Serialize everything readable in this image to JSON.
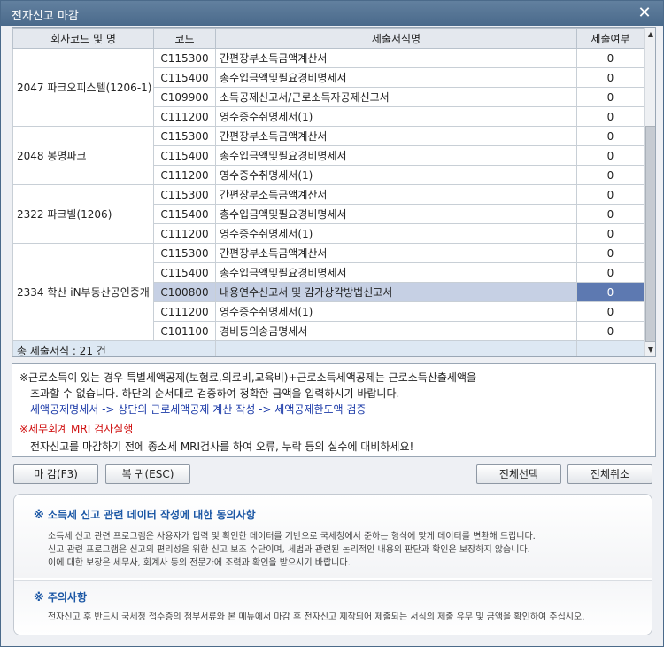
{
  "window": {
    "title": "전자신고 마감",
    "close_glyph": "✕"
  },
  "grid": {
    "headers": [
      "회사코드 및 명",
      "코드",
      "제출서식명",
      "제출여부"
    ],
    "companies": [
      {
        "name": "2047 파크오피스텔(1206-1)",
        "rows": [
          {
            "code": "C115300",
            "form": "간편장부소득금액계산서",
            "count": "0"
          },
          {
            "code": "C115400",
            "form": "총수입금액및필요경비명세서",
            "count": "0"
          },
          {
            "code": "C109900",
            "form": "소득공제신고서/근로소득자공제신고서",
            "count": "0"
          },
          {
            "code": "C111200",
            "form": "영수증수취명세서(1)",
            "count": "0"
          }
        ]
      },
      {
        "name": "2048 봉명파크",
        "rows": [
          {
            "code": "C115300",
            "form": "간편장부소득금액계산서",
            "count": "0"
          },
          {
            "code": "C115400",
            "form": "총수입금액및필요경비명세서",
            "count": "0"
          },
          {
            "code": "C111200",
            "form": "영수증수취명세서(1)",
            "count": "0"
          }
        ]
      },
      {
        "name": "2322 파크빌(1206)",
        "rows": [
          {
            "code": "C115300",
            "form": "간편장부소득금액계산서",
            "count": "0"
          },
          {
            "code": "C115400",
            "form": "총수입금액및필요경비명세서",
            "count": "0"
          },
          {
            "code": "C111200",
            "form": "영수증수취명세서(1)",
            "count": "0"
          }
        ]
      },
      {
        "name": "2334 학산 iN부동산공인중개",
        "rows": [
          {
            "code": "C115300",
            "form": "간편장부소득금액계산서",
            "count": "0"
          },
          {
            "code": "C115400",
            "form": "총수입금액및필요경비명세서",
            "count": "0"
          },
          {
            "code": "C100800",
            "form": "내용연수신고서 및 감가상각방법신고서",
            "count": "0",
            "selected": true
          },
          {
            "code": "C111200",
            "form": "영수증수취명세서(1)",
            "count": "0"
          },
          {
            "code": "C101100",
            "form": "경비등의송금명세서",
            "count": "0"
          }
        ]
      }
    ],
    "total": "총 제출서식 : 21 건"
  },
  "notice": {
    "line1": "※근로소득이 있는 경우 특별세액공제(보험료,의료비,교육비)+근로소득세액공제는 근로소득산출세액을",
    "line2": "초과할 수 없습니다. 하단의 순서대로 검증하여 정확한 금액을 입력하시기 바랍니다.",
    "line3": "세액공제명세서 -> 상단의 근로세액공제 계산 작성 -> 세액공제한도액 검증",
    "line4": "※세무회계 MRI 검사실행",
    "line5": "전자신고를 마감하기 전에 종소세 MRI검사를 하여 오류, 누락 등의 실수에 대비하세요!"
  },
  "buttons": {
    "close": "마 감(F3)",
    "back": "복 귀(ESC)",
    "select_all": "전체선택",
    "cancel_all": "전체취소"
  },
  "consent": {
    "title1": "※ 소득세 신고 관련 데이터 작성에 대한 동의사항",
    "p1a": "소득세 신고 관련 프로그램은 사용자가 입력 및 확인한 데이터를 기반으로 국세청에서 준하는 형식에 맞게 데이터를 변환해 드립니다.",
    "p1b": "신고 관련 프로그램은 신고의 편리성을 위한 신고 보조 수단이며, 세법과 관련된 논리적인 내용의 판단과 확인은 보장하지 않습니다.",
    "p1c": "이에 대한 보장은 세무사, 회계사 등의 전문가에 조력과 확인을 받으시기 바랍니다.",
    "title2": "※ 주의사항",
    "p2": "전자신고 후 반드시 국세청 접수증의 첨부서류와 본 메뉴에서 마감 후 전자신고 제작되어 제출되는 서식의 제출 유무 및 금액을 확인하여 주십시오."
  }
}
